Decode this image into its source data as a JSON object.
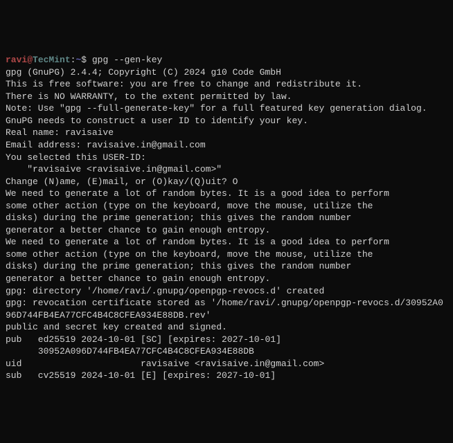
{
  "prompt": {
    "user": "ravi",
    "at": "@",
    "host": "TecMint",
    "colon": ":",
    "path": "~",
    "dollar": "$ ",
    "command": "gpg --gen-key"
  },
  "lines": {
    "l1": "gpg (GnuPG) 2.4.4; Copyright (C) 2024 g10 Code GmbH",
    "l2": "This is free software: you are free to change and redistribute it.",
    "l3": "There is NO WARRANTY, to the extent permitted by law.",
    "l4": "",
    "l5": "Note: Use \"gpg --full-generate-key\" for a full featured key generation dialog.",
    "l6": "",
    "l7": "GnuPG needs to construct a user ID to identify your key.",
    "l8": "",
    "l9": "Real name: ravisaive",
    "l10": "Email address: ravisaive.in@gmail.com",
    "l11": "You selected this USER-ID:",
    "l12": "    \"ravisaive <ravisaive.in@gmail.com>\"",
    "l13": "",
    "l14": "Change (N)ame, (E)mail, or (O)kay/(Q)uit? O",
    "l15": "We need to generate a lot of random bytes. It is a good idea to perform",
    "l16": "some other action (type on the keyboard, move the mouse, utilize the",
    "l17": "disks) during the prime generation; this gives the random number",
    "l18": "generator a better chance to gain enough entropy.",
    "l19": "We need to generate a lot of random bytes. It is a good idea to perform",
    "l20": "some other action (type on the keyboard, move the mouse, utilize the",
    "l21": "disks) during the prime generation; this gives the random number",
    "l22": "generator a better chance to gain enough entropy.",
    "l23": "gpg: directory '/home/ravi/.gnupg/openpgp-revocs.d' created",
    "l24": "gpg: revocation certificate stored as '/home/ravi/.gnupg/openpgp-revocs.d/30952A096D744FB4EA77CFC4B4C8CFEA934E88DB.rev'",
    "l25": "public and secret key created and signed.",
    "l26": "",
    "l27": "pub   ed25519 2024-10-01 [SC] [expires: 2027-10-01]",
    "l28": "      30952A096D744FB4EA77CFC4B4C8CFEA934E88DB",
    "l29": "uid                      ravisaive <ravisaive.in@gmail.com>",
    "l30": "sub   cv25519 2024-10-01 [E] [expires: 2027-10-01]"
  }
}
